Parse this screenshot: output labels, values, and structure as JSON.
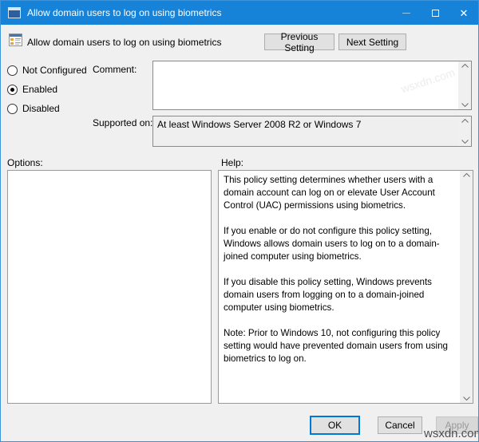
{
  "window": {
    "title": "Allow domain users to log on using biometrics"
  },
  "header": {
    "setting_name": "Allow domain users to log on using biometrics",
    "previous_button": "Previous Setting",
    "next_button": "Next Setting"
  },
  "state_radios": [
    {
      "label": "Not Configured",
      "selected": false
    },
    {
      "label": "Enabled",
      "selected": true
    },
    {
      "label": "Disabled",
      "selected": false
    }
  ],
  "comment": {
    "label": "Comment:",
    "value": ""
  },
  "supported_on": {
    "label": "Supported on:",
    "value": "At least Windows Server 2008 R2 or Windows 7"
  },
  "options_panel": {
    "label": "Options:"
  },
  "help_panel": {
    "label": "Help:",
    "paragraphs": [
      "This policy setting determines whether users with a domain account can log on or elevate User Account Control (UAC) permissions using biometrics.",
      "If you enable or do not configure this policy setting, Windows allows domain users to log on to a domain-joined computer using biometrics.",
      "If you disable this policy setting, Windows prevents domain users from logging on to a domain-joined computer using biometrics.",
      "Note: Prior to Windows 10, not configuring this policy setting would have prevented domain users from using biometrics to log on."
    ]
  },
  "footer": {
    "ok_button": "OK",
    "cancel_button": "Cancel",
    "apply_button": "Apply"
  },
  "watermark": {
    "text": "wsxdn.com"
  },
  "colors": {
    "titlebar": "#1683d8",
    "accent": "#0078d7",
    "dialog_bg": "#f0f0f0",
    "disabled_text": "#9a9a9a"
  }
}
